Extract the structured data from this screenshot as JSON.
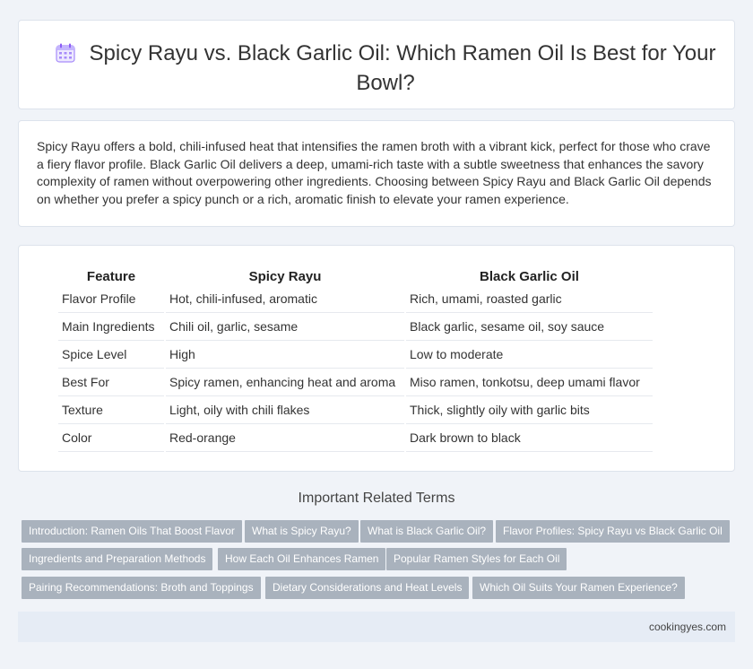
{
  "header": {
    "title": "Spicy Rayu vs. Black Garlic Oil: Which Ramen Oil Is Best for Your Bowl?",
    "icon": "calendar-icon"
  },
  "intro": {
    "text": "Spicy Rayu offers a bold, chili-infused heat that intensifies the ramen broth with a vibrant kick, perfect for those who crave a fiery flavor profile. Black Garlic Oil delivers a deep, umami-rich taste with a subtle sweetness that enhances the savory complexity of ramen without overpowering other ingredients. Choosing between Spicy Rayu and Black Garlic Oil depends on whether you prefer a spicy punch or a rich, aromatic finish to elevate your ramen experience."
  },
  "table": {
    "headers": [
      "Feature",
      "Spicy Rayu",
      "Black Garlic Oil"
    ],
    "rows": [
      [
        "Flavor Profile",
        "Hot, chili-infused, aromatic",
        "Rich, umami, roasted garlic"
      ],
      [
        "Main Ingredients",
        "Chili oil, garlic, sesame",
        "Black garlic, sesame oil, soy sauce"
      ],
      [
        "Spice Level",
        "High",
        "Low to moderate"
      ],
      [
        "Best For",
        "Spicy ramen, enhancing heat and aroma",
        "Miso ramen, tonkotsu, deep umami flavor"
      ],
      [
        "Texture",
        "Light, oily with chili flakes",
        "Thick, slightly oily with garlic bits"
      ],
      [
        "Color",
        "Red-orange",
        "Dark brown to black"
      ]
    ]
  },
  "related": {
    "heading": "Important Related Terms",
    "tags": [
      "Introduction: Ramen Oils That Boost Flavor",
      "What is Spicy Rayu?",
      "What is Black Garlic Oil?",
      "Flavor Profiles: Spicy Rayu vs Black Garlic Oil",
      "Ingredients and Preparation Methods",
      "How Each Oil Enhances Ramen",
      "Popular Ramen Styles for Each Oil",
      "Pairing Recommendations: Broth and Toppings",
      "Dietary Considerations and Heat Levels",
      "Which Oil Suits Your Ramen Experience?"
    ]
  },
  "footer": {
    "site": "cookingyes.com"
  },
  "colors": {
    "background": "#f0f3f8",
    "tag_background": "#a9b2bd",
    "footer_background": "#e6ecf5",
    "icon_accent": "#a78bfa"
  }
}
